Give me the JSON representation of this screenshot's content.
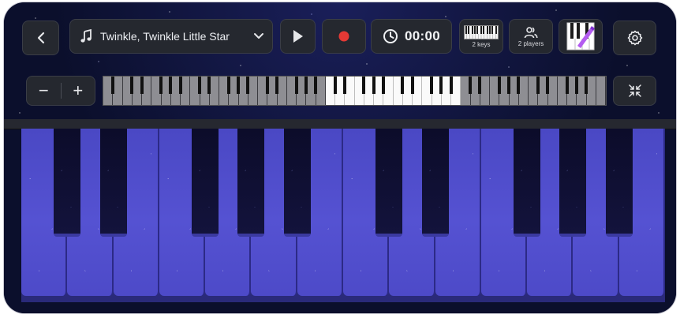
{
  "toolbar": {
    "back_icon": "chevron-left-icon",
    "song": {
      "icon": "music-note-icon",
      "title": "Twinkle, Twinkle Little Star",
      "dropdown_icon": "chevron-down-icon"
    },
    "play_icon": "play-icon",
    "record_icon": "record-icon",
    "record_color": "#e53935",
    "timer": {
      "icon": "clock-icon",
      "value": "00:00"
    },
    "keys_button": {
      "icon": "mini-keyboard-icon",
      "label": "2 keys"
    },
    "players_button": {
      "icon": "users-icon",
      "label": "2 players"
    },
    "theme_button": {
      "icon": "piano-theme-icon"
    },
    "settings_icon": "gear-icon"
  },
  "navigator": {
    "zoom_out_label": "−",
    "zoom_in_label": "+",
    "collapse_icon": "collapse-arrows-icon"
  },
  "keyboard": {
    "white_key_count": 14,
    "black_key_count": 10,
    "theme_colors": {
      "white_key": "#5552d2",
      "black_key": "#0c0c2a",
      "background": "#0b0f2c"
    }
  }
}
